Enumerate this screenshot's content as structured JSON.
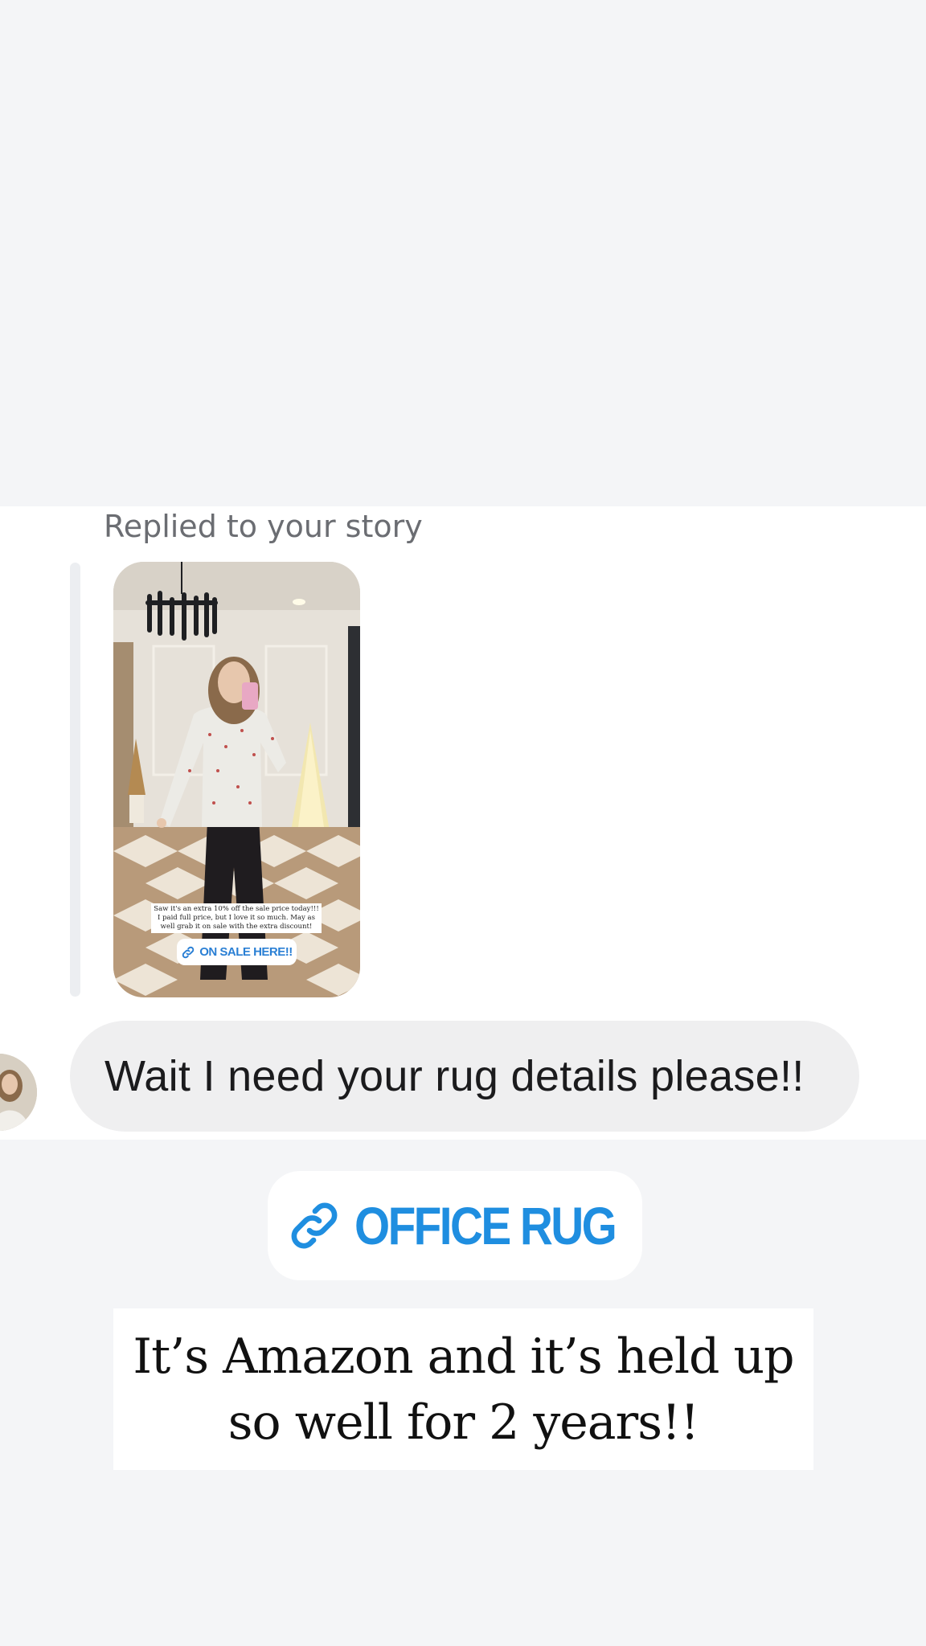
{
  "reply": {
    "label": "Replied to your story"
  },
  "story": {
    "caption": "Saw it's an extra 10% off the sale price today!!! I paid full price, but I love it so much. May as well grab it on sale with the extra discount!",
    "link_label": "ON SALE HERE!!",
    "link_icon": "link-icon"
  },
  "message": {
    "text": "Wait I need your rug details please!!"
  },
  "link_sticker": {
    "label": "OFFICE RUG",
    "icon": "link-icon"
  },
  "caption": {
    "line1": "It’s Amazon and it’s held up",
    "line2": "so well for 2 years!!"
  },
  "colors": {
    "background": "#f4f5f7",
    "bubble": "#efeff0",
    "link_blue": "#1f8ee0",
    "label_gray": "#6b6d72"
  }
}
